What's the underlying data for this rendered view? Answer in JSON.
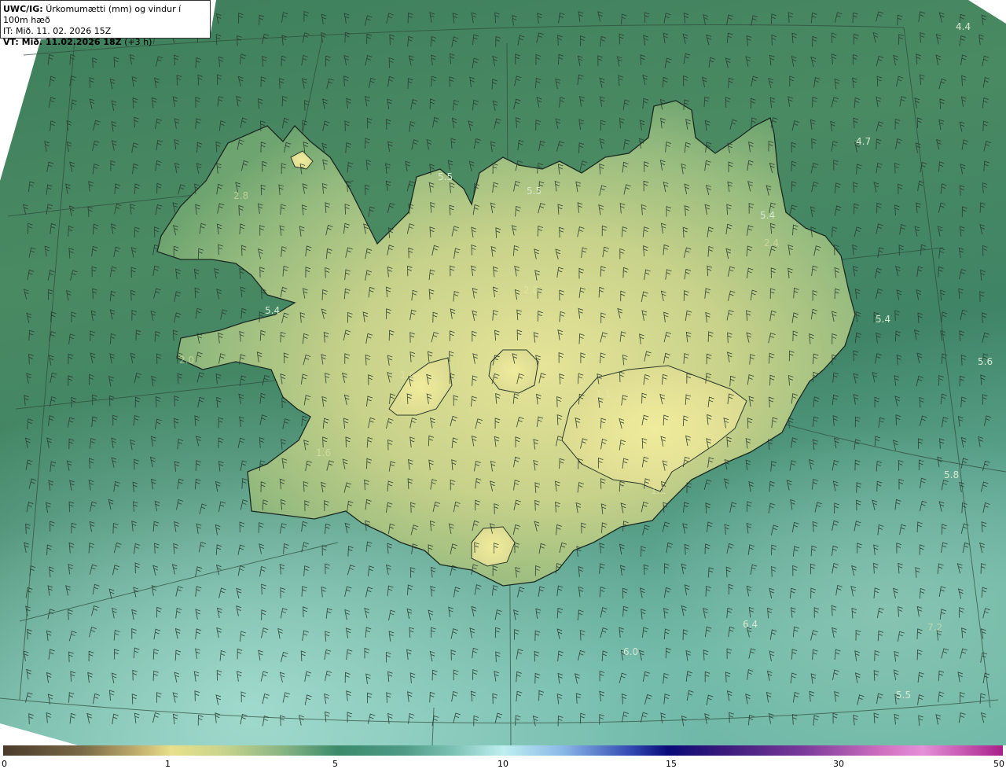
{
  "header": {
    "product": "UWC/IG:",
    "title": "Úrkomumætti (mm) og vindur í 100m hæð",
    "it_line": "IT: Mið. 11. 02. 2026 15Z",
    "vt_label": "VT: Mið. 11.02.2026 18Z",
    "vt_offset": "(+3 h)"
  },
  "map_labels": {
    "l01": "4.4",
    "l02": "4.7",
    "l03": "5.5",
    "l04": "5.5",
    "l05": "2.8",
    "l06": "5.4",
    "l07": "2.4",
    "l08": "5.4",
    "l09": "5.4",
    "l10": "5.6",
    "l11": "5.8",
    "l12": "6.4",
    "l13": "7.2",
    "l14": "6.0",
    "l15": "5.5",
    "l16": "2.0",
    "l17": "2.0",
    "l18": "1.6",
    "l19": "1.3",
    "l20": "1.1",
    "l21": "1.1",
    "l22": "1.1",
    "l23": "1.6"
  },
  "legend": {
    "ticks": [
      "0",
      "1",
      "5",
      "10",
      "15",
      "30",
      "50"
    ]
  },
  "colors": {
    "sea_dark": "#3c7a5c",
    "sea_light": "#9fd8cc",
    "land_low": "#6ea872",
    "land_high": "#e4e294",
    "coast": "#1a2a22",
    "barb": "#2a3a30"
  }
}
